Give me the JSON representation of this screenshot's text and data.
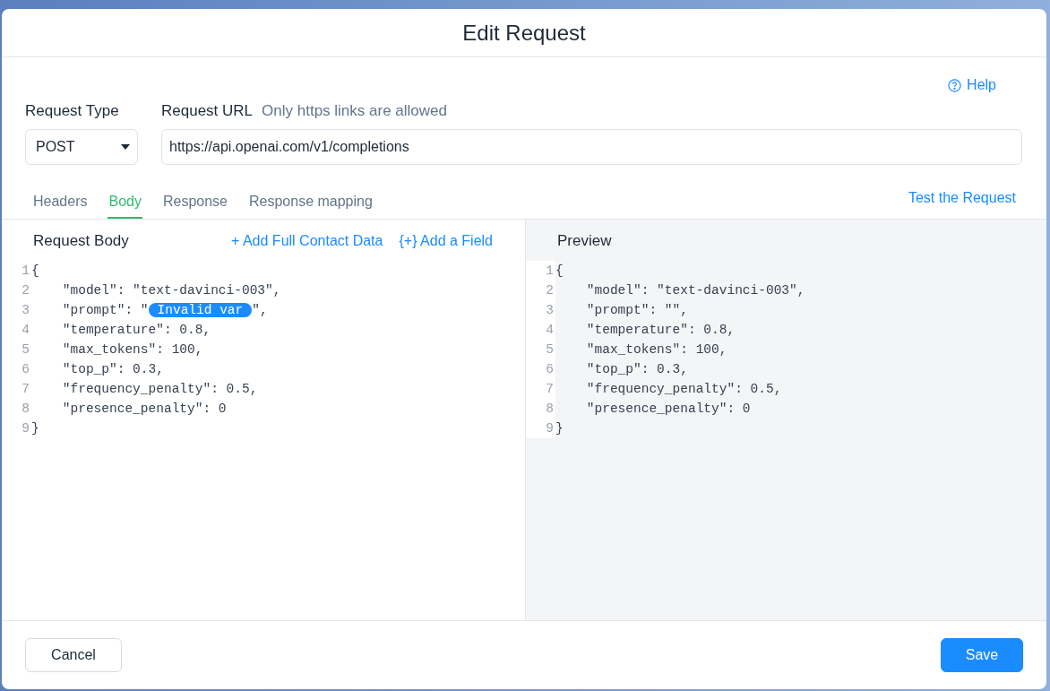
{
  "dialog": {
    "title": "Edit Request"
  },
  "help": {
    "label": "Help"
  },
  "request_type": {
    "label": "Request Type",
    "value": "POST"
  },
  "request_url": {
    "label": "Request URL",
    "hint": "Only https links are allowed",
    "value": "https://api.openai.com/v1/completions"
  },
  "tabs": [
    {
      "label": "Headers",
      "selected": false
    },
    {
      "label": "Body",
      "selected": true
    },
    {
      "label": "Response",
      "selected": false
    },
    {
      "label": "Response mapping",
      "selected": false
    }
  ],
  "test_link": "Test the Request",
  "request_body": {
    "title": "Request Body",
    "actions": [
      "+ Add Full Contact Data",
      "{+} Add a Field"
    ],
    "lines": [
      {
        "number": "1",
        "segments": [
          {
            "kind": "text",
            "text": "{"
          }
        ]
      },
      {
        "number": "2",
        "segments": [
          {
            "kind": "text",
            "text": "    \"model\": \"text-davinci-003\","
          }
        ]
      },
      {
        "number": "3",
        "segments": [
          {
            "kind": "text",
            "text": "    \"prompt\": \""
          },
          {
            "kind": "token",
            "text": "Invalid var"
          },
          {
            "kind": "text",
            "text": "\","
          }
        ]
      },
      {
        "number": "4",
        "segments": [
          {
            "kind": "text",
            "text": "    \"temperature\": 0.8,"
          }
        ]
      },
      {
        "number": "5",
        "segments": [
          {
            "kind": "text",
            "text": "    \"max_tokens\": 100,"
          }
        ]
      },
      {
        "number": "6",
        "segments": [
          {
            "kind": "text",
            "text": "    \"top_p\": 0.3,"
          }
        ]
      },
      {
        "number": "7",
        "segments": [
          {
            "kind": "text",
            "text": "    \"frequency_penalty\": 0.5,"
          }
        ]
      },
      {
        "number": "8",
        "segments": [
          {
            "kind": "text",
            "text": "    \"presence_penalty\": 0"
          }
        ]
      },
      {
        "number": "9",
        "segments": [
          {
            "kind": "text",
            "text": "}"
          }
        ]
      }
    ]
  },
  "preview": {
    "title": "Preview",
    "lines": [
      {
        "number": "1",
        "segments": [
          {
            "kind": "text",
            "text": "{"
          }
        ]
      },
      {
        "number": "2",
        "segments": [
          {
            "kind": "text",
            "text": "    \"model\": \"text-davinci-003\","
          }
        ]
      },
      {
        "number": "3",
        "segments": [
          {
            "kind": "text",
            "text": "    \"prompt\": \"\","
          }
        ]
      },
      {
        "number": "4",
        "segments": [
          {
            "kind": "text",
            "text": "    \"temperature\": 0.8,"
          }
        ]
      },
      {
        "number": "5",
        "segments": [
          {
            "kind": "text",
            "text": "    \"max_tokens\": 100,"
          }
        ]
      },
      {
        "number": "6",
        "segments": [
          {
            "kind": "text",
            "text": "    \"top_p\": 0.3,"
          }
        ]
      },
      {
        "number": "7",
        "segments": [
          {
            "kind": "text",
            "text": "    \"frequency_penalty\": 0.5,"
          }
        ]
      },
      {
        "number": "8",
        "segments": [
          {
            "kind": "text",
            "text": "    \"presence_penalty\": 0"
          }
        ]
      },
      {
        "number": "9",
        "segments": [
          {
            "kind": "text",
            "text": "}"
          }
        ]
      }
    ]
  },
  "buttons": [
    {
      "label": "Cancel",
      "kind": "secondary"
    },
    {
      "label": "Save",
      "kind": "primary"
    }
  ]
}
